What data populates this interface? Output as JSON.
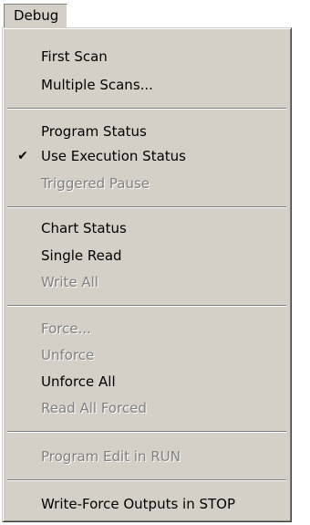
{
  "menu_title": "Debug",
  "items": [
    {
      "label": "First Scan",
      "enabled": true
    },
    {
      "label": "Multiple Scans...",
      "enabled": true
    },
    {
      "label": "Program Status",
      "enabled": true
    },
    {
      "label": "Use Execution Status",
      "enabled": true,
      "checked": true,
      "check_glyph": "✔"
    },
    {
      "label": "Triggered Pause",
      "enabled": false
    },
    {
      "label": "Chart Status",
      "enabled": true
    },
    {
      "label": "Single Read",
      "enabled": true
    },
    {
      "label": "Write All",
      "enabled": false
    },
    {
      "label": "Force...",
      "enabled": false
    },
    {
      "label": "Unforce",
      "enabled": false
    },
    {
      "label": "Unforce All",
      "enabled": true
    },
    {
      "label": "Read All Forced",
      "enabled": false
    },
    {
      "label": "Program Edit in RUN",
      "enabled": false
    },
    {
      "label": "Write-Force Outputs in STOP",
      "enabled": true
    }
  ],
  "colors": {
    "menu_background": "#d4d0c8",
    "text": "#000000",
    "disabled_text": "#808080"
  },
  "icons": {
    "check": "checkmark-icon"
  }
}
